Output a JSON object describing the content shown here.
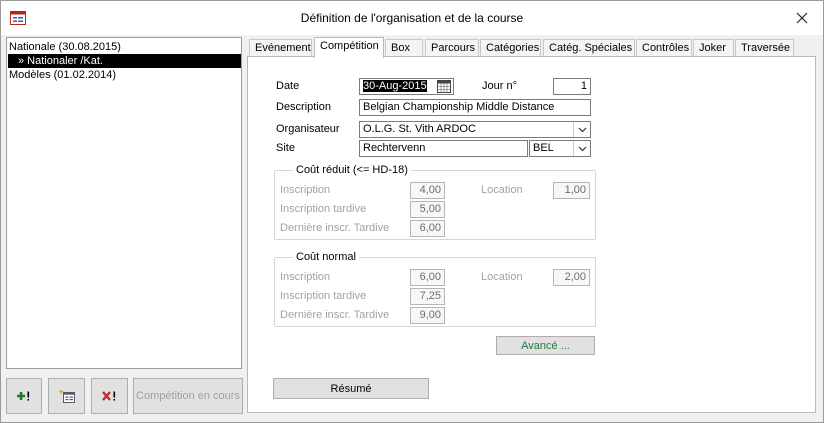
{
  "window": {
    "title": "Définition de l'organisation et de la course"
  },
  "tree": {
    "items": [
      {
        "label": "Nationale (30.08.2015)",
        "selected": false
      },
      {
        "label": "» Nationaler /Kat.",
        "selected": true
      },
      {
        "label": "Modèles (01.02.2014)",
        "selected": false
      }
    ]
  },
  "toolbar": {
    "competition_in_progress_label": "Compétition en cours"
  },
  "tabs": [
    {
      "label": "Evénement",
      "active": false
    },
    {
      "label": "Compétition",
      "active": true
    },
    {
      "label": "Box",
      "active": false
    },
    {
      "label": "Parcours",
      "active": false
    },
    {
      "label": "Catégories",
      "active": false
    },
    {
      "label": "Catég. Spéciales",
      "active": false
    },
    {
      "label": "Contrôles",
      "active": false
    },
    {
      "label": "Joker",
      "active": false
    },
    {
      "label": "Traversée",
      "active": false
    }
  ],
  "form": {
    "date_label": "Date",
    "date_value": "30-Aug-2015",
    "day_label": "Jour n°",
    "day_value": "1",
    "description_label": "Description",
    "description_value": "Belgian Championship Middle Distance",
    "organizer_label": "Organisateur",
    "organizer_value": "O.L.G. St. Vith ARDOC",
    "site_label": "Site",
    "site_value": "Rechtervenn",
    "country_value": "BEL"
  },
  "reduced_cost": {
    "title": "Coût réduit (<= HD-18)",
    "registration_label": "Inscription",
    "registration_value": "4,00",
    "late_label": "Inscription tardive",
    "late_value": "5,00",
    "last_late_label": "Dernière inscr. Tardive",
    "last_late_value": "6,00",
    "rental_label": "Location",
    "rental_value": "1,00"
  },
  "normal_cost": {
    "title": "Coût normal",
    "registration_label": "Inscription",
    "registration_value": "6,00",
    "late_label": "Inscription tardive",
    "late_value": "7,25",
    "last_late_label": "Dernière inscr. Tardive",
    "last_late_value": "9,00",
    "rental_label": "Location",
    "rental_value": "2,00"
  },
  "buttons": {
    "advanced_label": "Avancé ...",
    "summary_label": "Résumé"
  },
  "colors": {
    "advanced_text": "#1e7a3c",
    "add_icon": "#1b7a2e",
    "delete_icon": "#c62828"
  }
}
